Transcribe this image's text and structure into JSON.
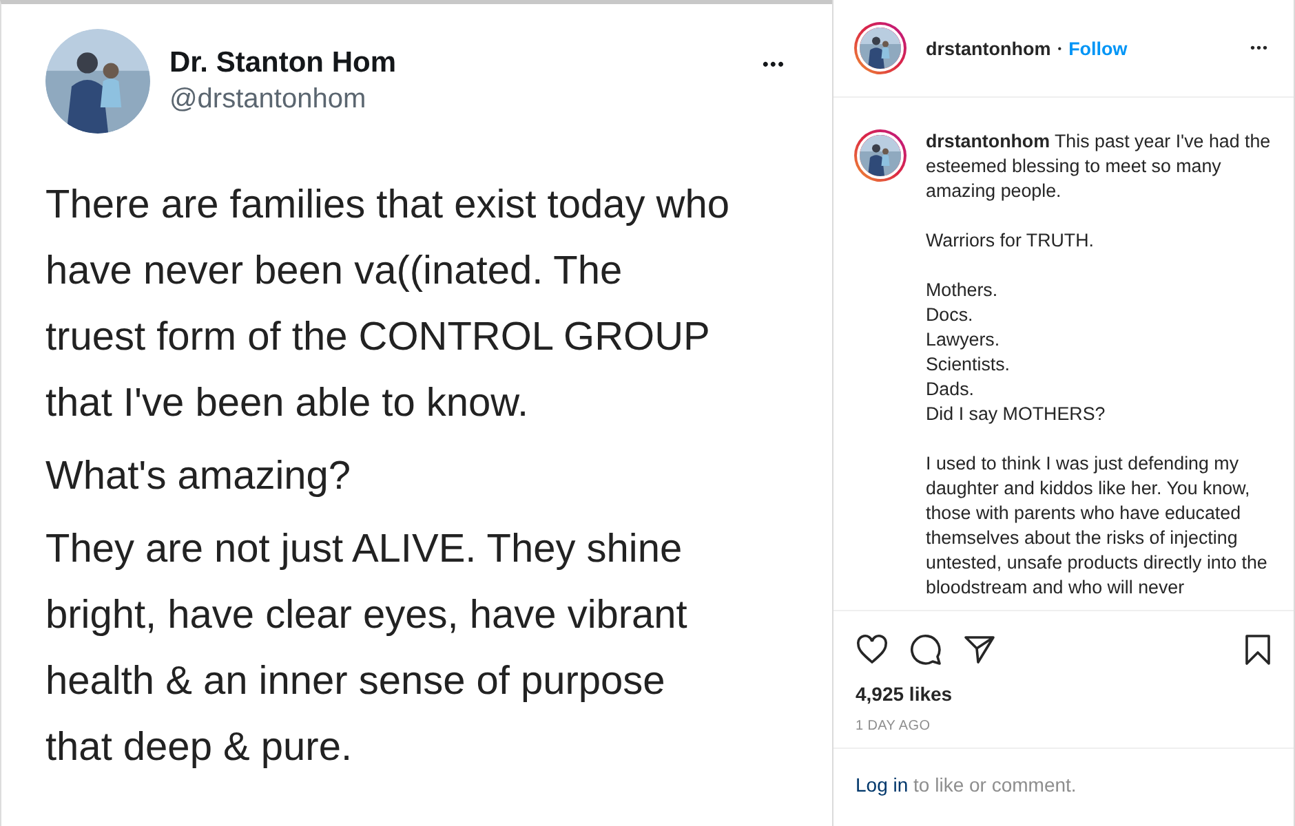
{
  "tweet": {
    "name": "Dr. Stanton Hom",
    "handle": "@drstantonhom",
    "more": "•••",
    "paragraphs": [
      [
        "There are families that exist today who",
        "have never been va((inated. The",
        "truest form of the CONTROL GROUP",
        "that I've been able to know."
      ],
      [
        "What's amazing?"
      ],
      [
        "They are not just ALIVE. They shine",
        "bright, have clear eyes, have vibrant",
        "health & an inner sense of purpose",
        "that deep & pure."
      ]
    ]
  },
  "post_header": {
    "username": "drstantonhom",
    "separator": "•",
    "follow": "Follow",
    "more": "•••"
  },
  "caption": {
    "username": "drstantonhom",
    "paragraphs": [
      [
        "This past year I've had the esteemed blessing to meet so many amazing people."
      ],
      [
        "Warriors for TRUTH."
      ],
      [
        "Mothers.",
        "Docs.",
        "Lawyers.",
        "Scientists.",
        "Dads.",
        "Did I say MOTHERS?"
      ],
      [
        "I used to think I was just defending my daughter and kiddos like her. You know, those with parents who have educated themselves about the risks of injecting untested, unsafe products directly into the bloodstream and who will never"
      ]
    ]
  },
  "likes": "4,925 likes",
  "time": "1 DAY AGO",
  "login": {
    "link": "Log in",
    "text": "to like or comment."
  }
}
